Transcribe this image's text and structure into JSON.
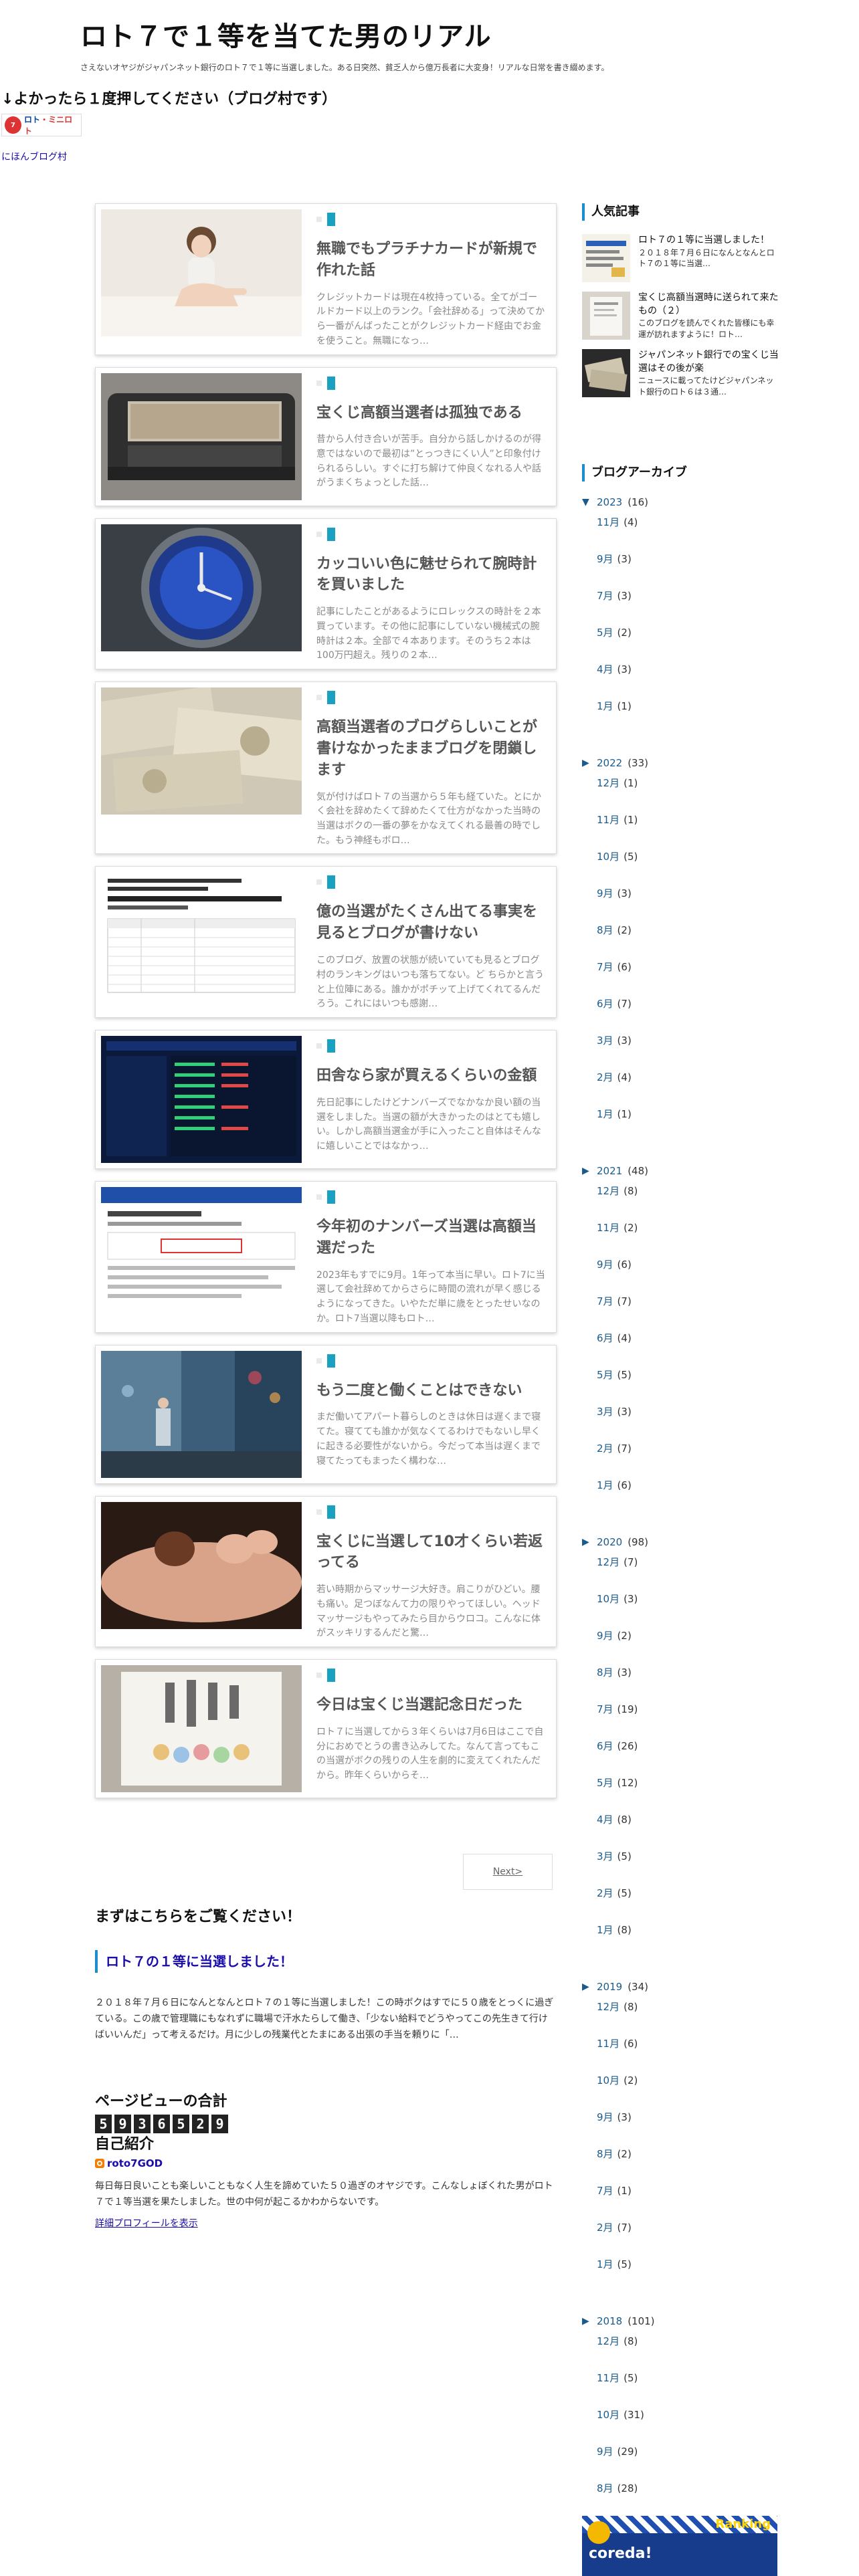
{
  "blog": {
    "title": "ロト７で１等を当てた男のリアル",
    "description": "さえないオヤジがジャパンネット銀行のロト７で１等に当選しました。ある日突然、貧乏人から億万長者に大変身！リアルな日常を書き綴めます。"
  },
  "vote": {
    "title": "↓よかったら１度押してください（ブログ村です）",
    "banner_ball": "7",
    "banner_text_1": "ロト",
    "banner_text_2": "・ミニロト",
    "link_label": "にほんブログ村"
  },
  "posts": [
    {
      "title": "無職でもプラチナカードが新規で作れた話",
      "excerpt": "クレジットカードは現在4枚持っている。全てがゴールドカード以上のランク。「会社辞める」って決めてから一番がんばったことがクレジットカード経由でお金を使うこと。無職になっ…"
    },
    {
      "title": "宝くじ高額当選者は孤独である",
      "excerpt": "昔から人付き合いが苦手。自分から話しかけるのが得意ではないので最初は”とっつきにくい人”と印象付けられるらしい。すぐに打ち解けて仲良くなれる人や話がうまくちょっとした話…"
    },
    {
      "title": "カッコいい色に魅せられて腕時計を買いました",
      "excerpt": "記事にしたことがあるようにロレックスの時計を２本買っています。その他に記事にしていない機械式の腕時計は２本。全部で４本あります。そのうち２本は100万円超え。残りの２本…"
    },
    {
      "title": "高額当選者のブログらしいことが書けなかったままブログを閉鎖します",
      "excerpt": "気が付けばロト７の当選から５年も経ていた。とにかく会社を辞めたくて辞めたくて仕方がなかった当時の当選はボクの一番の夢をかなえてくれる最善の時でした。もう神経もボロ…"
    },
    {
      "title": "億の当選がたくさん出てる事実を見るとブログが書けない",
      "excerpt": "このブログ、放置の状態が続いていても見るとブログ村のランキングはいつも落ちてない。ど ちらかと言うと上位陣にある。誰かがポチッて上げてくれてるんだろう。これにはいつも感謝…"
    },
    {
      "title": "田舎なら家が買えるくらいの金額",
      "excerpt": "先日記事にしたけどナンバーズでなかなか良い額の当選をしました。当選の額が大きかったのはとても嬉しい。しかし高額当選金が手に入ったこと自体はそんなに嬉しいことではなかっ…"
    },
    {
      "title": "今年初のナンバーズ当選は高額当選だった",
      "excerpt": "2023年もすでに9月。1年って本当に早い。ロト7に当選して会社辞めてからさらに時間の流れが早く感じるようになってきた。いやただ単に歳をとったせいなのか。ロト7当選以降もロト…"
    },
    {
      "title": "もう二度と働くことはできない",
      "excerpt": "まだ働いてアパート暮らしのときは休日は遅くまで寝てた。寝てても誰かが気なくてるわけでもないし早くに起きる必要性がないから。今だって本当は遅くまで寝てたってもまったく構わな…"
    },
    {
      "title": "宝くじに当選して10才くらい若返ってる",
      "excerpt": "若い時期からマッサージ大好き。肩こりがひどい。腰も痛い。足つぼなんて力の限りやってほしい。ヘッドマッサージもやってみたら目からウロコ。こんなに体がスッキリするんだと驚…"
    },
    {
      "title": "今日は宝くじ当選記念日だった",
      "excerpt": "ロト７に当選してから３年くらいは7月6日はここで自分におめでとうの書き込みしてた。なんて言ってもこの当選がボクの残りの人生を劇的に変えてくれたんだから。昨年くらいからそ…"
    }
  ],
  "pager": {
    "next_label": "Next>"
  },
  "featured": {
    "heading": "まずはこちらをご覧ください！",
    "post_title": "ロト７の１等に当選しました！",
    "excerpt": "２０１８年７月６日になんとなんとロト７の１等に当選しました！この時ボクはすでに５０歳をとっくに過ぎている。この歳で管理職にもなれずに職場で汗水たらして働き、「少ない給料でどうやってこの先生きて行けばいいんだ」って考えるだけ。月に少しの残業代とたまにある出張の手当を頼りに「…"
  },
  "pageviews": {
    "heading": "ページビューの合計",
    "digits": [
      "5",
      "9",
      "3",
      "6",
      "5",
      "2",
      "9"
    ]
  },
  "about": {
    "heading": "自己紹介",
    "name": "roto7GOD",
    "text": "毎日毎日良いことも楽しいこともなく人生を諦めていた５０過ぎのオヤジです。こんなしょぼくれた男がロト７で１等当選を果たしました。世の中何が起こるかわからないです。",
    "link_label": "詳細プロフィールを表示"
  },
  "sidebar": {
    "popular_heading": "人気記事",
    "popular": [
      {
        "title": "ロト７の１等に当選しました！",
        "excerpt": "２０１８年７月６日になんとなんとロト７の１等に当選…"
      },
      {
        "title": "宝くじ高額当選時に送られて来たもの（２）",
        "excerpt": "このブログを読んでくれた皆様にも幸運が訪れますように！ロト…"
      },
      {
        "title": "ジャパンネット銀行での宝くじ当選はその後が楽",
        "excerpt": "ニュースに載ってたけどジャパンネット銀行のロト６は３通…"
      }
    ],
    "archive_heading": "ブログアーカイブ",
    "archive": [
      {
        "year": "2023",
        "count": "(16)",
        "open": true,
        "months": [
          {
            "m": "11月",
            "c": "(4)"
          },
          {
            "m": "9月",
            "c": "(3)"
          },
          {
            "m": "7月",
            "c": "(3)"
          },
          {
            "m": "5月",
            "c": "(2)"
          },
          {
            "m": "4月",
            "c": "(3)"
          },
          {
            "m": "1月",
            "c": "(1)"
          }
        ]
      },
      {
        "year": "2022",
        "count": "(33)",
        "open": false,
        "months": [
          {
            "m": "12月",
            "c": "(1)"
          },
          {
            "m": "11月",
            "c": "(1)"
          },
          {
            "m": "10月",
            "c": "(5)"
          },
          {
            "m": "9月",
            "c": "(3)"
          },
          {
            "m": "8月",
            "c": "(2)"
          },
          {
            "m": "7月",
            "c": "(6)"
          },
          {
            "m": "6月",
            "c": "(7)"
          },
          {
            "m": "3月",
            "c": "(3)"
          },
          {
            "m": "2月",
            "c": "(4)"
          },
          {
            "m": "1月",
            "c": "(1)"
          }
        ]
      },
      {
        "year": "2021",
        "count": "(48)",
        "open": false,
        "months": [
          {
            "m": "12月",
            "c": "(8)"
          },
          {
            "m": "11月",
            "c": "(2)"
          },
          {
            "m": "9月",
            "c": "(6)"
          },
          {
            "m": "7月",
            "c": "(7)"
          },
          {
            "m": "6月",
            "c": "(4)"
          },
          {
            "m": "5月",
            "c": "(5)"
          },
          {
            "m": "3月",
            "c": "(3)"
          },
          {
            "m": "2月",
            "c": "(7)"
          },
          {
            "m": "1月",
            "c": "(6)"
          }
        ]
      },
      {
        "year": "2020",
        "count": "(98)",
        "open": false,
        "months": [
          {
            "m": "12月",
            "c": "(7)"
          },
          {
            "m": "10月",
            "c": "(3)"
          },
          {
            "m": "9月",
            "c": "(2)"
          },
          {
            "m": "8月",
            "c": "(3)"
          },
          {
            "m": "7月",
            "c": "(19)"
          },
          {
            "m": "6月",
            "c": "(26)"
          },
          {
            "m": "5月",
            "c": "(12)"
          },
          {
            "m": "4月",
            "c": "(8)"
          },
          {
            "m": "3月",
            "c": "(5)"
          },
          {
            "m": "2月",
            "c": "(5)"
          },
          {
            "m": "1月",
            "c": "(8)"
          }
        ]
      },
      {
        "year": "2019",
        "count": "(34)",
        "open": false,
        "months": [
          {
            "m": "12月",
            "c": "(8)"
          },
          {
            "m": "11月",
            "c": "(6)"
          },
          {
            "m": "10月",
            "c": "(2)"
          },
          {
            "m": "9月",
            "c": "(3)"
          },
          {
            "m": "8月",
            "c": "(2)"
          },
          {
            "m": "7月",
            "c": "(1)"
          },
          {
            "m": "2月",
            "c": "(7)"
          },
          {
            "m": "1月",
            "c": "(5)"
          }
        ]
      },
      {
        "year": "2018",
        "count": "(101)",
        "open": false,
        "months": [
          {
            "m": "12月",
            "c": "(8)"
          },
          {
            "m": "11月",
            "c": "(5)"
          },
          {
            "m": "10月",
            "c": "(31)"
          },
          {
            "m": "9月",
            "c": "(29)"
          },
          {
            "m": "8月",
            "c": "(28)"
          }
        ]
      }
    ],
    "ranking_label": "Ranking",
    "ranking_brand": "coreda!"
  },
  "colors": {
    "accent": "#1a8ccf",
    "link": "#1a0dab",
    "archive_link": "#1a5b8c"
  }
}
